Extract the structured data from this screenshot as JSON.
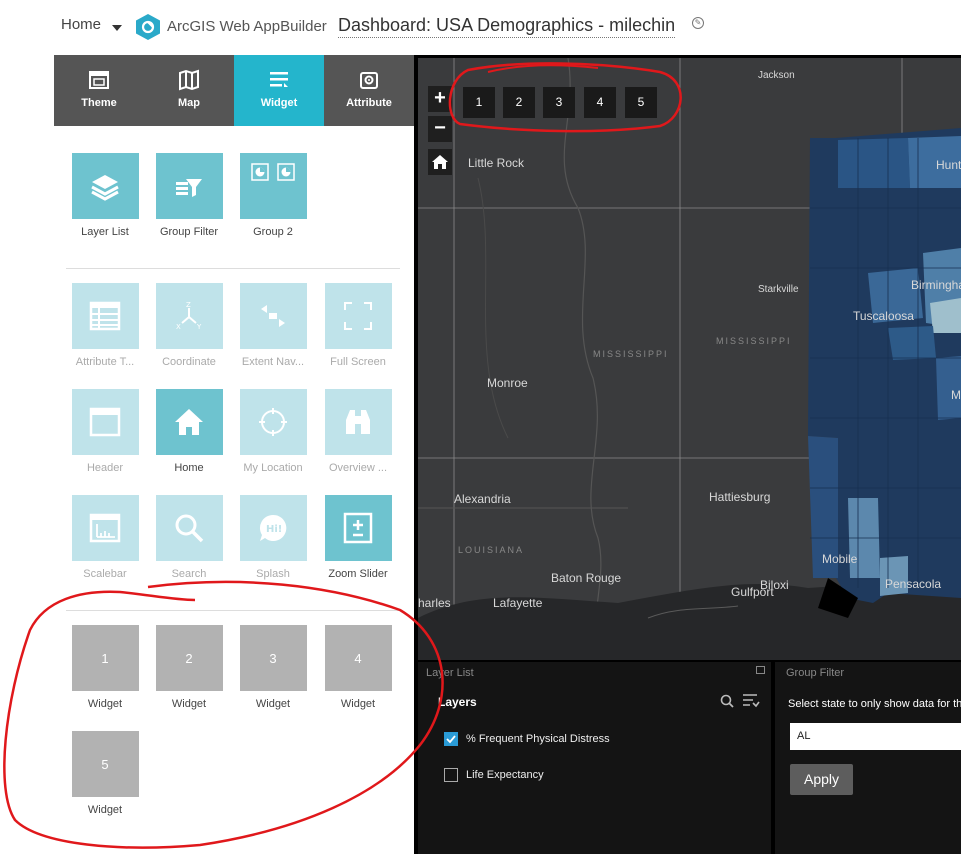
{
  "header": {
    "home_label": "Home",
    "app_name": "ArcGIS Web AppBuilder",
    "app_title": "Dashboard: USA Demographics - milechin"
  },
  "tabs": [
    {
      "label": "Theme",
      "icon": "theme-icon"
    },
    {
      "label": "Map",
      "icon": "map-icon"
    },
    {
      "label": "Widget",
      "icon": "widget-icon",
      "active": true
    },
    {
      "label": "Attribute",
      "icon": "attribute-icon"
    }
  ],
  "widget_groups": {
    "group1": [
      {
        "label": "Layer List",
        "icon": "layer-list-icon"
      },
      {
        "label": "Group Filter",
        "icon": "group-filter-icon"
      },
      {
        "label": "Group 2",
        "icon": "group-icon"
      }
    ],
    "group2": [
      {
        "label": "Attribute T...",
        "icon": "attribute-table-icon"
      },
      {
        "label": "Coordinate",
        "icon": "coordinate-icon"
      },
      {
        "label": "Extent Nav...",
        "icon": "extent-navigate-icon"
      },
      {
        "label": "Full Screen",
        "icon": "full-screen-icon"
      },
      {
        "label": "Header",
        "icon": "header-icon"
      },
      {
        "label": "Home",
        "icon": "home-icon",
        "active": true
      },
      {
        "label": "My Location",
        "icon": "my-location-icon"
      },
      {
        "label": "Overview ...",
        "icon": "overview-map-icon"
      },
      {
        "label": "Scalebar",
        "icon": "scalebar-icon"
      },
      {
        "label": "Search",
        "icon": "search-icon"
      },
      {
        "label": "Splash",
        "icon": "splash-icon"
      },
      {
        "label": "Zoom Slider",
        "icon": "zoom-slider-icon",
        "active": true
      }
    ],
    "placeholders": [
      {
        "num": "1",
        "label": "Widget"
      },
      {
        "num": "2",
        "label": "Widget"
      },
      {
        "num": "3",
        "label": "Widget"
      },
      {
        "num": "4",
        "label": "Widget"
      },
      {
        "num": "5",
        "label": "Widget"
      }
    ]
  },
  "map": {
    "zoom_in": "+",
    "zoom_out": "−",
    "placeholder_buttons": [
      "1",
      "2",
      "3",
      "4",
      "5"
    ],
    "labels": {
      "jackson": "Jackson",
      "little_rock": "Little Rock",
      "huntsville": "Hunt",
      "starkville": "Starkville",
      "birmingham": "Birmingha",
      "tuscaloosa": "Tuscaloosa",
      "mississippi1": "MISSISSIPPI",
      "mississippi2": "MISSISSIPPI",
      "monroe": "Monroe",
      "montgomery": "M",
      "alexandria": "Alexandria",
      "hattiesburg": "Hattiesburg",
      "louisiana": "LOUISIANA",
      "mobile": "Mobile",
      "baton_rouge": "Baton Rouge",
      "biloxi": "Biloxi",
      "gulfport": "Gulfport",
      "pensacola": "Pensacola",
      "charles": "harles",
      "lafayette": "Lafayette"
    }
  },
  "layer_list": {
    "title": "Layer List",
    "heading": "Layers",
    "layers": [
      {
        "label": "% Frequent Physical Distress",
        "checked": true
      },
      {
        "label": "Life Expectancy",
        "checked": false
      }
    ]
  },
  "group_filter": {
    "title": "Group Filter",
    "description": "Select state to only show data for th",
    "value": "AL",
    "apply_label": "Apply"
  },
  "colors": {
    "accent": "#24b5cc",
    "tile_on": "#6ec3cf",
    "tile_off": "#bfe3ea",
    "annotation": "#e0181b"
  }
}
